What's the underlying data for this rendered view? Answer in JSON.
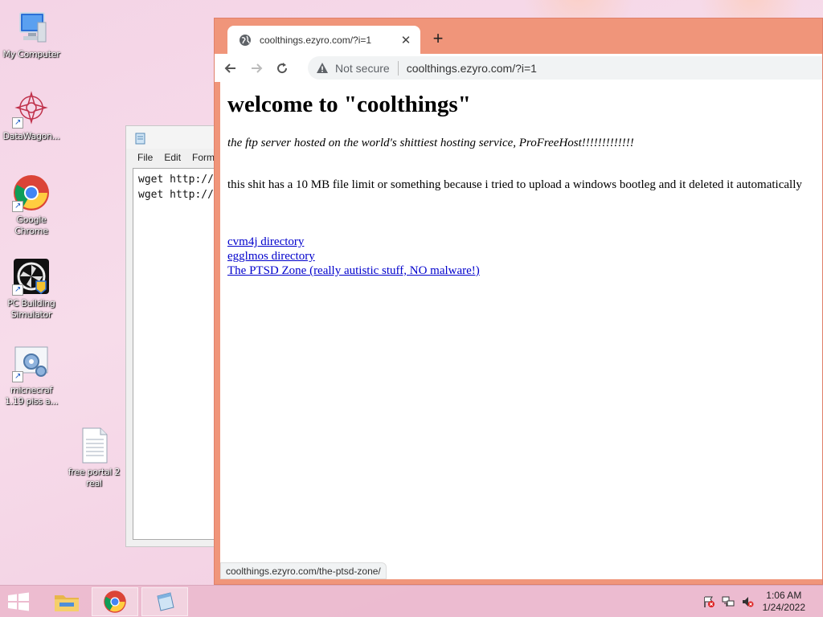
{
  "desktop": {
    "icons": [
      {
        "label": "My Computer",
        "icon": "computer-icon"
      },
      {
        "label": "DataWagon...",
        "icon": "datawagon-icon"
      },
      {
        "label": "Google Chrome",
        "icon": "chrome-icon"
      },
      {
        "label": "PC Building Simulator",
        "icon": "pc-building-simulator-icon"
      },
      {
        "label": "micnecraf 1.19 piss a...",
        "icon": "setup-gear-icon"
      },
      {
        "label": "free portal 2 real",
        "icon": "text-file-icon"
      }
    ]
  },
  "notepad": {
    "menu": [
      "File",
      "Edit",
      "Form"
    ],
    "lines": [
      "wget http://",
      "wget http://"
    ]
  },
  "chrome": {
    "tab_title": "coolthings.ezyro.com/?i=1",
    "not_secure": "Not secure",
    "url": "coolthings.ezyro.com/?i=1",
    "status_url": "coolthings.ezyro.com/the-ptsd-zone/"
  },
  "page": {
    "heading": "welcome to \"coolthings\"",
    "tagline": "the ftp server hosted on the world's shittiest hosting service, ProFreeHost!!!!!!!!!!!!!",
    "body": "this shit has a 10 MB file limit or something because i tried to upload a windows bootleg and it deleted it automatically",
    "links": [
      "cvm4j directory",
      "egglmos directory",
      "The PTSD Zone (really autistic stuff, NO malware!)"
    ]
  },
  "taskbar": {
    "time": "1:06 AM",
    "date": "1/24/2022"
  },
  "colors": {
    "chrome_frame": "#f0957a",
    "link": "#0000cc",
    "taskbar": "#ecbace"
  }
}
